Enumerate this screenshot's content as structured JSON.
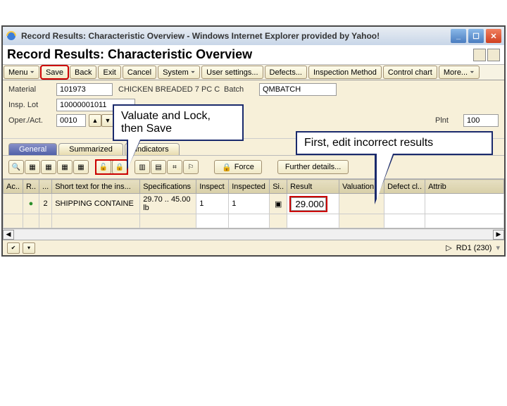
{
  "window": {
    "title": "Record Results: Characteristic Overview - Windows Internet Explorer provided by Yahoo!"
  },
  "heading": "Record Results: Characteristic Overview",
  "menubar": {
    "menu": "Menu",
    "save": "Save",
    "back": "Back",
    "exit": "Exit",
    "cancel": "Cancel",
    "system": "System",
    "user_settings": "User settings...",
    "defects": "Defects...",
    "inspection_method": "Inspection Method",
    "control_chart": "Control chart",
    "more": "More..."
  },
  "form": {
    "material_label": "Material",
    "material_value": "101973",
    "material_desc": "CHICKEN BREADED 7 PC C",
    "batch_label": "Batch",
    "batch_value": "QMBATCH",
    "insp_lot_label": "Insp. Lot",
    "insp_lot_value": "10000001011",
    "oper_label": "Oper./Act.",
    "oper_value": "0010",
    "plnt_label": "Plnt",
    "plnt_value": "100"
  },
  "tabs": {
    "general": "General",
    "summarized": "Summarized",
    "indicators": "Indicators"
  },
  "toolbar": {
    "force": "Force",
    "further": "Further details..."
  },
  "table": {
    "headers": {
      "ac": "Ac..",
      "r": "R..",
      "dots": "...",
      "shorttext": "Short text for the ins...",
      "spec": "Specifications",
      "inspect": "Inspect",
      "inspected": "Inspected",
      "si": "Si..",
      "result": "Result",
      "valuation": "Valuation",
      "defect": "Defect cl..",
      "attrib": "Attrib"
    },
    "row": {
      "num": "2",
      "shorttext": "SHIPPING CONTAINE",
      "spec": "29.70 .. 45.00 lb",
      "inspect": "1",
      "inspected": "1",
      "result": "29.000"
    }
  },
  "status": {
    "system": "RD1 (230)"
  },
  "callouts": {
    "c1": "Valuate and Lock, then Save",
    "c2": "First, edit incorrect results"
  }
}
